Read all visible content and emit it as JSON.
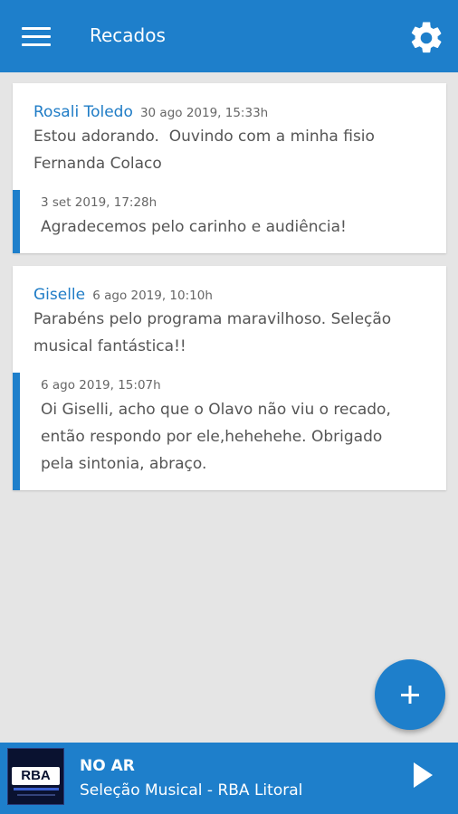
{
  "appbar": {
    "title": "Recados",
    "menu_icon": "menu-icon",
    "settings_icon": "gear-icon"
  },
  "messages": [
    {
      "author": "Rosali Toledo",
      "date": "30 ago 2019, 15:33h",
      "text_lines": [
        "Estou adorando.  Ouvindo com a minha fisio",
        "Fernanda Colaco"
      ],
      "reply": {
        "date": "3 set 2019, 17:28h",
        "text_lines": [
          "Agradecemos pelo carinho e audiência!"
        ]
      }
    },
    {
      "author": "Giselle",
      "date": "6 ago 2019, 10:10h",
      "text_lines": [
        "Parabéns pelo programa maravilhoso. Seleção",
        "musical fantástica!!"
      ],
      "reply": {
        "date": "6 ago 2019, 15:07h",
        "text_lines": [
          "Oi Giselli, acho que o Olavo não viu o recado,",
          "então respondo por ele,hehehehe. Obrigado",
          "pela sintonia, abraço."
        ]
      }
    }
  ],
  "fab": {
    "icon": "plus-icon"
  },
  "player": {
    "logo_text": "RBA",
    "status": "NO AR",
    "program": "Seleção Musical - RBA Litoral",
    "play_icon": "play-icon"
  },
  "colors": {
    "primary": "#1e7fcb",
    "background": "#e5e5e5",
    "author": "#1f7cc6"
  }
}
